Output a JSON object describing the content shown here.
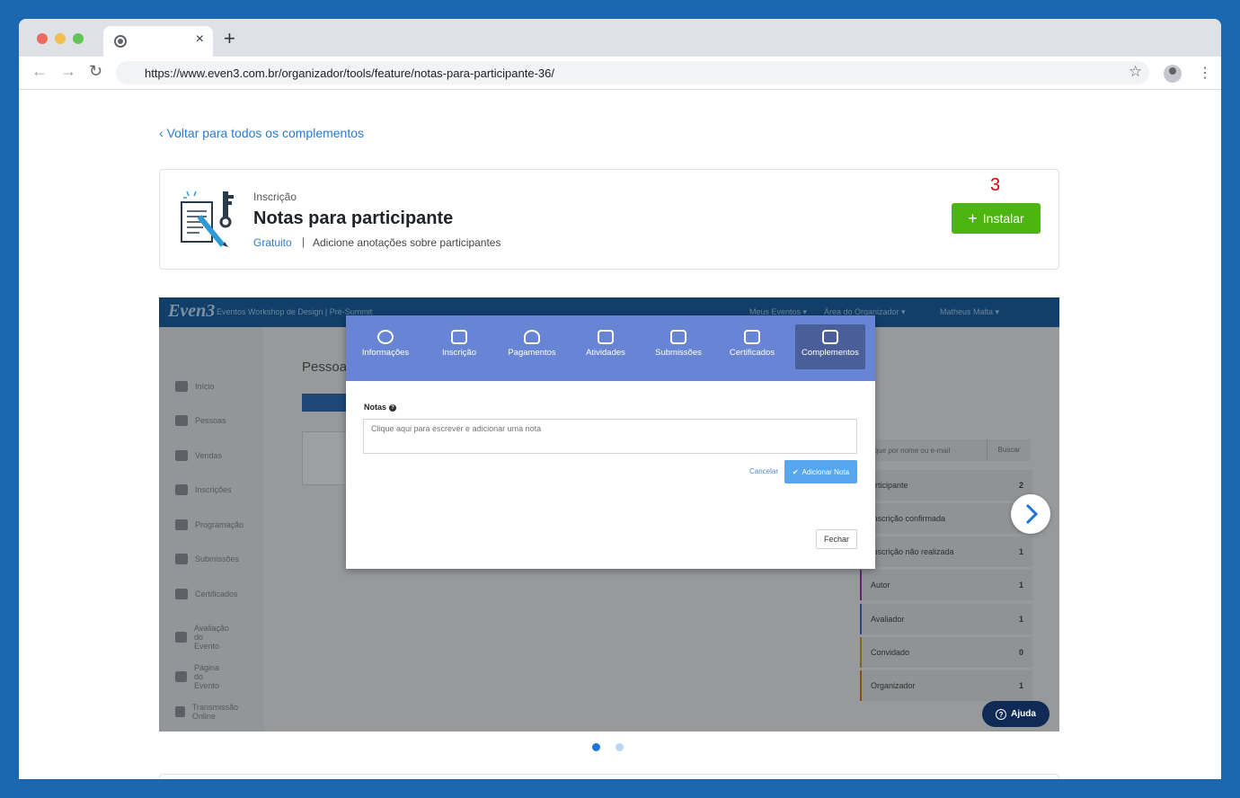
{
  "browser": {
    "url": "https://www.even3.com.br/organizador/tools/feature/notas-para-participante-36/",
    "new_tab_label": "+",
    "tab_close_label": "×"
  },
  "page": {
    "back_link": "Voltar para todos os complementos",
    "category": "Inscrição",
    "title": "Notas para participante",
    "price": "Gratuito",
    "separator": "|",
    "description": "Adicione anotações sobre participantes",
    "step_marker": "3",
    "install_label": "Instalar",
    "install_plus": "+"
  },
  "screenshot": {
    "logo": "Even3",
    "header_event": "Eventos   Workshop de Design | Pré-Summit",
    "header_nav": [
      "Meus Eventos ▾",
      "Área do Organizador ▾",
      "Matheus Malta ▾"
    ],
    "page_heading": "Pessoa",
    "sidebar": [
      "Início",
      "Pessoas",
      "Vendas",
      "Inscrições",
      "Programação",
      "Submissões",
      "Certificados",
      "Avaliação do Evento",
      "Página do Evento",
      "Transmissão Online"
    ],
    "search_placeholder": "ique por nome ou e-mail",
    "search_button": "Buscar",
    "stats": [
      {
        "label": "articipante",
        "value": "2"
      },
      {
        "label": "Inscrição confirmada",
        "value": ""
      },
      {
        "label": "Inscrição não realizada",
        "value": "1"
      },
      {
        "label": "Autor",
        "value": "1"
      },
      {
        "label": "Avaliador",
        "value": "1"
      },
      {
        "label": "Convidado",
        "value": "0"
      },
      {
        "label": "Organizador",
        "value": "1"
      }
    ],
    "modal": {
      "tabs": [
        "Informações",
        "Inscrição",
        "Pagamentos",
        "Atividades",
        "Submissões",
        "Certificados",
        "Complementos"
      ],
      "active_tab": "Complementos",
      "notes_label": "Notas",
      "notes_placeholder": "Clique aqui para escrever e adicionar uma nota",
      "cancel_label": "Cancelar",
      "add_note_label": "Adicionar Nota",
      "close_label": "Fechar"
    },
    "help_label": "Ajuda"
  },
  "carousel": {
    "active_index": 0,
    "total": 2
  },
  "colors": {
    "page_bg": "#1b67b0",
    "accent_link": "#2a7bd0",
    "install_green": "#4cb50f",
    "step_red": "#e00000",
    "modal_header": "#6785d4",
    "help_dark": "#0e2a55"
  }
}
